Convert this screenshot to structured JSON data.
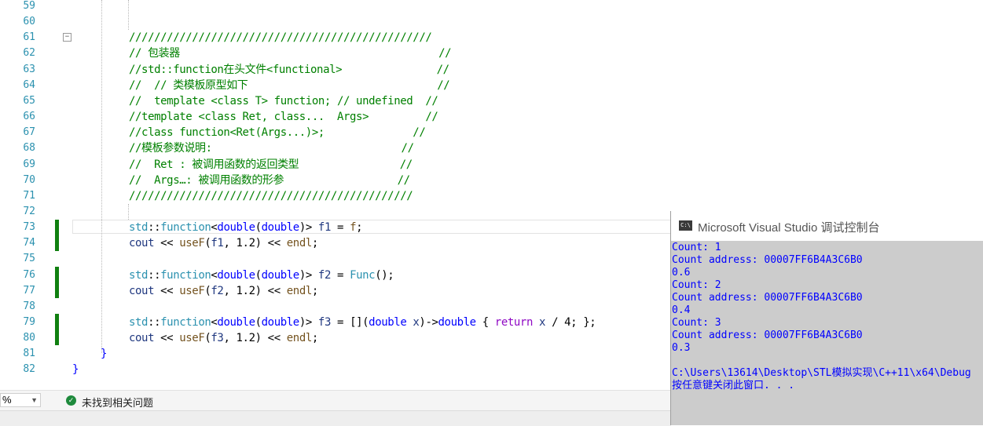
{
  "editor": {
    "lines": [
      {
        "num": "59",
        "segments": []
      },
      {
        "num": "60",
        "segments": []
      },
      {
        "num": "61",
        "segments": [
          {
            "text": "////////////////////////////////////////////////",
            "c": "cm"
          }
        ]
      },
      {
        "num": "62",
        "segments": [
          {
            "text": "// 包装器                                         //",
            "c": "cm"
          }
        ]
      },
      {
        "num": "63",
        "segments": [
          {
            "text": "//std::function在头文件<functional>               //",
            "c": "cm"
          }
        ]
      },
      {
        "num": "64",
        "segments": [
          {
            "text": "//  // 类模板原型如下                              //",
            "c": "cm"
          }
        ]
      },
      {
        "num": "65",
        "segments": [
          {
            "text": "//  template <class T> function; // undefined  //",
            "c": "cm"
          }
        ]
      },
      {
        "num": "66",
        "segments": [
          {
            "text": "//template <class Ret, class...  Args>         //",
            "c": "cm"
          }
        ]
      },
      {
        "num": "67",
        "segments": [
          {
            "text": "//class function<Ret(Args...)>;              //",
            "c": "cm"
          }
        ]
      },
      {
        "num": "68",
        "segments": [
          {
            "text": "//模板参数说明:                              //",
            "c": "cm"
          }
        ]
      },
      {
        "num": "69",
        "segments": [
          {
            "text": "//  Ret : 被调用函数的返回类型                //",
            "c": "cm"
          }
        ]
      },
      {
        "num": "70",
        "segments": [
          {
            "text": "//  Args…: 被调用函数的形参                  //",
            "c": "cm"
          }
        ]
      },
      {
        "num": "71",
        "segments": [
          {
            "text": "/////////////////////////////////////////////",
            "c": "cm"
          }
        ]
      },
      {
        "num": "72",
        "segments": []
      },
      {
        "num": "73",
        "segments": [
          {
            "text": "std",
            "c": "ty"
          },
          {
            "text": "::",
            "c": ""
          },
          {
            "text": "function",
            "c": "cls"
          },
          {
            "text": "<",
            "c": ""
          },
          {
            "text": "double",
            "c": "kw"
          },
          {
            "text": "(",
            "c": ""
          },
          {
            "text": "double",
            "c": "kw"
          },
          {
            "text": ")> ",
            "c": ""
          },
          {
            "text": "f1",
            "c": "vr"
          },
          {
            "text": " = ",
            "c": ""
          },
          {
            "text": "f",
            "c": "fn"
          },
          {
            "text": ";",
            "c": ""
          }
        ]
      },
      {
        "num": "74",
        "segments": [
          {
            "text": "cout",
            "c": "vr"
          },
          {
            "text": " << ",
            "c": ""
          },
          {
            "text": "useF",
            "c": "fn"
          },
          {
            "text": "(",
            "c": ""
          },
          {
            "text": "f1",
            "c": "vr"
          },
          {
            "text": ", 1.2) << ",
            "c": ""
          },
          {
            "text": "endl",
            "c": "fn"
          },
          {
            "text": ";",
            "c": ""
          }
        ]
      },
      {
        "num": "75",
        "segments": []
      },
      {
        "num": "76",
        "segments": [
          {
            "text": "std",
            "c": "ty"
          },
          {
            "text": "::",
            "c": ""
          },
          {
            "text": "function",
            "c": "cls"
          },
          {
            "text": "<",
            "c": ""
          },
          {
            "text": "double",
            "c": "kw"
          },
          {
            "text": "(",
            "c": ""
          },
          {
            "text": "double",
            "c": "kw"
          },
          {
            "text": ")> ",
            "c": ""
          },
          {
            "text": "f2",
            "c": "vr"
          },
          {
            "text": " = ",
            "c": ""
          },
          {
            "text": "Func",
            "c": "cls"
          },
          {
            "text": "();",
            "c": ""
          }
        ]
      },
      {
        "num": "77",
        "segments": [
          {
            "text": "cout",
            "c": "vr"
          },
          {
            "text": " << ",
            "c": ""
          },
          {
            "text": "useF",
            "c": "fn"
          },
          {
            "text": "(",
            "c": ""
          },
          {
            "text": "f2",
            "c": "vr"
          },
          {
            "text": ", 1.2) << ",
            "c": ""
          },
          {
            "text": "endl",
            "c": "fn"
          },
          {
            "text": ";",
            "c": ""
          }
        ]
      },
      {
        "num": "78",
        "segments": []
      },
      {
        "num": "79",
        "segments": [
          {
            "text": "std",
            "c": "ty"
          },
          {
            "text": "::",
            "c": ""
          },
          {
            "text": "function",
            "c": "cls"
          },
          {
            "text": "<",
            "c": ""
          },
          {
            "text": "double",
            "c": "kw"
          },
          {
            "text": "(",
            "c": ""
          },
          {
            "text": "double",
            "c": "kw"
          },
          {
            "text": ")> ",
            "c": ""
          },
          {
            "text": "f3",
            "c": "vr"
          },
          {
            "text": " = [](",
            "c": ""
          },
          {
            "text": "double",
            "c": "kw"
          },
          {
            "text": " ",
            "c": ""
          },
          {
            "text": "x",
            "c": "vr"
          },
          {
            "text": ")->",
            "c": ""
          },
          {
            "text": "double",
            "c": "kw"
          },
          {
            "text": " { ",
            "c": ""
          },
          {
            "text": "return",
            "c": "ctl"
          },
          {
            "text": " ",
            "c": ""
          },
          {
            "text": "x",
            "c": "vr"
          },
          {
            "text": " / 4; };",
            "c": ""
          }
        ]
      },
      {
        "num": "80",
        "segments": [
          {
            "text": "cout",
            "c": "vr"
          },
          {
            "text": " << ",
            "c": ""
          },
          {
            "text": "useF",
            "c": "fn"
          },
          {
            "text": "(",
            "c": ""
          },
          {
            "text": "f3",
            "c": "vr"
          },
          {
            "text": ", 1.2) << ",
            "c": ""
          },
          {
            "text": "endl",
            "c": "fn"
          },
          {
            "text": ";",
            "c": ""
          }
        ]
      },
      {
        "num": "81",
        "segments": [
          {
            "text": "}",
            "c": "kw"
          }
        ]
      },
      {
        "num": "82",
        "segments": [
          {
            "text": "}",
            "c": "kw"
          }
        ]
      }
    ]
  },
  "statusbar": {
    "zoom": "%",
    "issues_text": "未找到相关问题"
  },
  "console": {
    "title": "Microsoft Visual Studio 调试控制台",
    "output": [
      "Count: 1",
      "Count address: 00007FF6B4A3C6B0",
      "0.6",
      "Count: 2",
      "Count address: 00007FF6B4A3C6B0",
      "0.4",
      "Count: 3",
      "Count address: 00007FF6B4A3C6B0",
      "0.3",
      "",
      "C:\\Users\\13614\\Desktop\\STL模拟实现\\C++11\\x64\\Debug",
      "按任意键关闭此窗口. . ."
    ]
  },
  "colors": {
    "line_number": "#2b91af",
    "comment": "#008000",
    "keyword": "#0000ff",
    "console_text": "#0000ff",
    "console_bg": "#cccccc",
    "change_bar": "#108010"
  }
}
